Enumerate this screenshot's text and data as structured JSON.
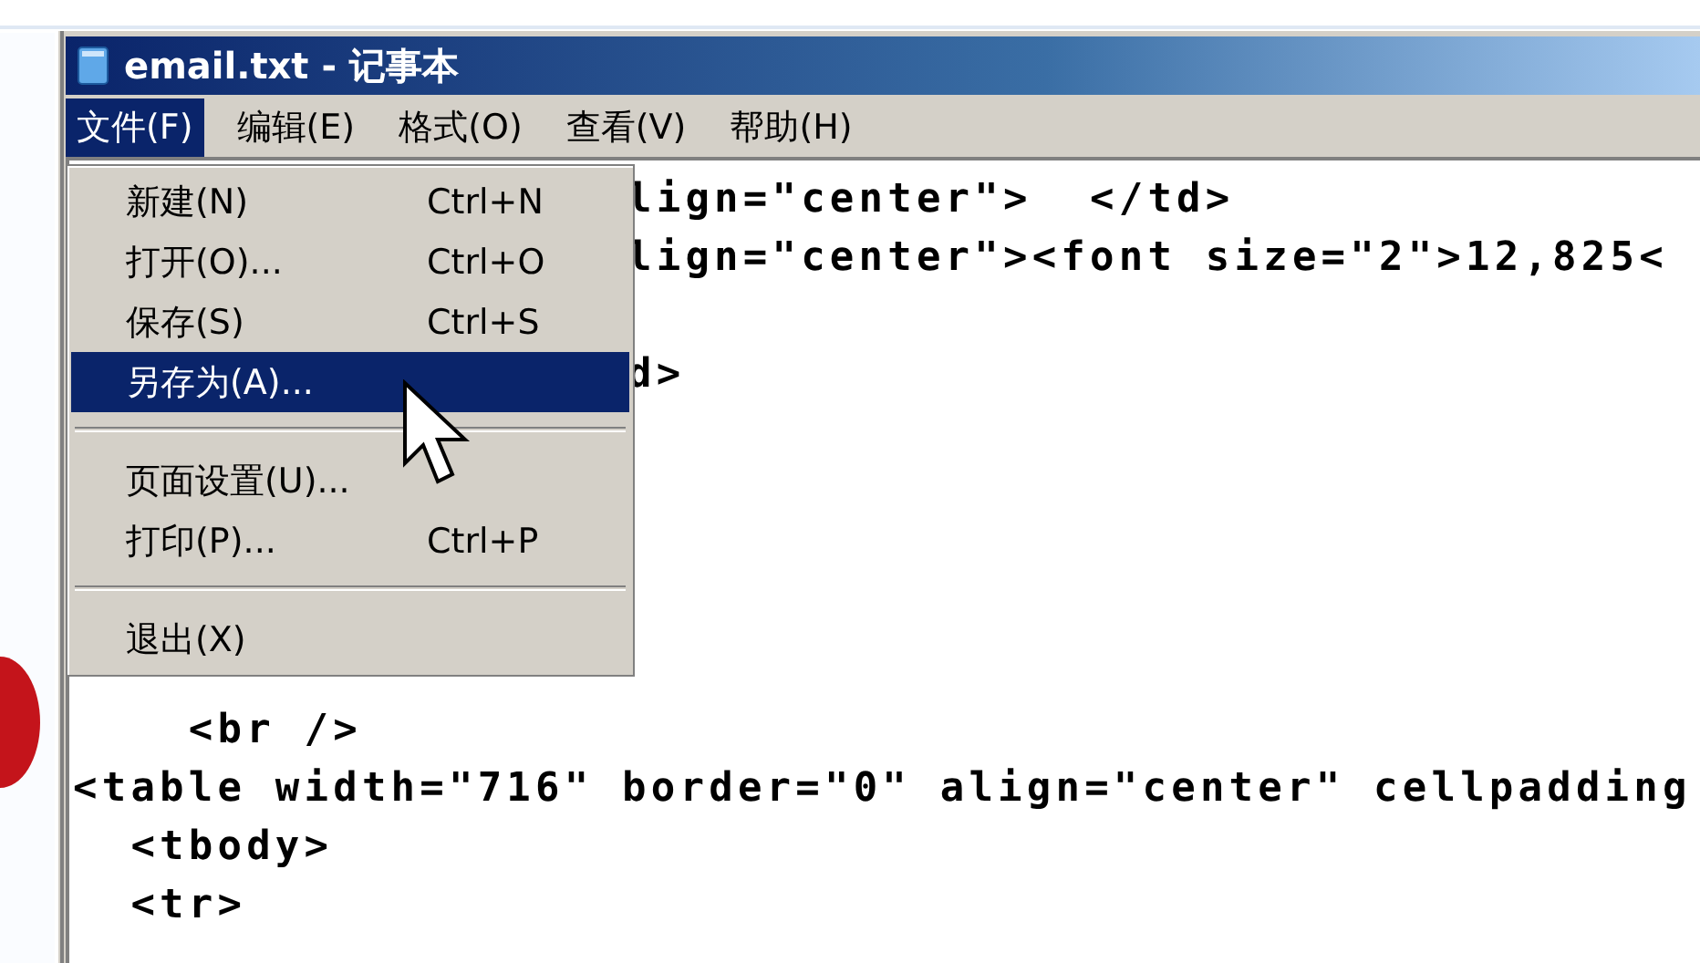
{
  "window": {
    "title": "email.txt - 记事本"
  },
  "menubar": [
    {
      "label": "文件(F)",
      "selected": true
    },
    {
      "label": "编辑(E)",
      "selected": false
    },
    {
      "label": "格式(O)",
      "selected": false
    },
    {
      "label": "查看(V)",
      "selected": false
    },
    {
      "label": "帮助(H)",
      "selected": false
    }
  ],
  "file_menu": [
    {
      "kind": "item",
      "label": "新建(N)",
      "shortcut": "Ctrl+N",
      "selected": false
    },
    {
      "kind": "item",
      "label": "打开(O)...",
      "shortcut": "Ctrl+O",
      "selected": false
    },
    {
      "kind": "item",
      "label": "保存(S)",
      "shortcut": "Ctrl+S",
      "selected": false
    },
    {
      "kind": "item",
      "label": "另存为(A)...",
      "selected": true
    },
    {
      "kind": "separator"
    },
    {
      "kind": "item",
      "label": "页面设置(U)...",
      "selected": false
    },
    {
      "kind": "item",
      "label": "打印(P)...",
      "shortcut": "Ctrl+P",
      "selected": false
    },
    {
      "kind": "separator"
    },
    {
      "kind": "item",
      "label": "退出(X)",
      "selected": false
    }
  ],
  "editor": {
    "lines_beside_menu": [
      {
        "kind": "text",
        "text": "lign=\"center\">  </td>"
      },
      {
        "kind": "text",
        "text": "lign=\"center\"><font size=\"2\">12,825<"
      },
      {
        "kind": "blank"
      },
      {
        "kind": "text",
        "text": "d>"
      }
    ],
    "lines_below_menu": [
      {
        "kind": "text",
        "text": "    <br />"
      },
      {
        "kind": "text",
        "text": "<table width=\"716\" border=\"0\" align=\"center\" cellpadding"
      },
      {
        "kind": "text",
        "text": "  <tbody>"
      },
      {
        "kind": "text",
        "text": "  <tr>"
      }
    ]
  }
}
